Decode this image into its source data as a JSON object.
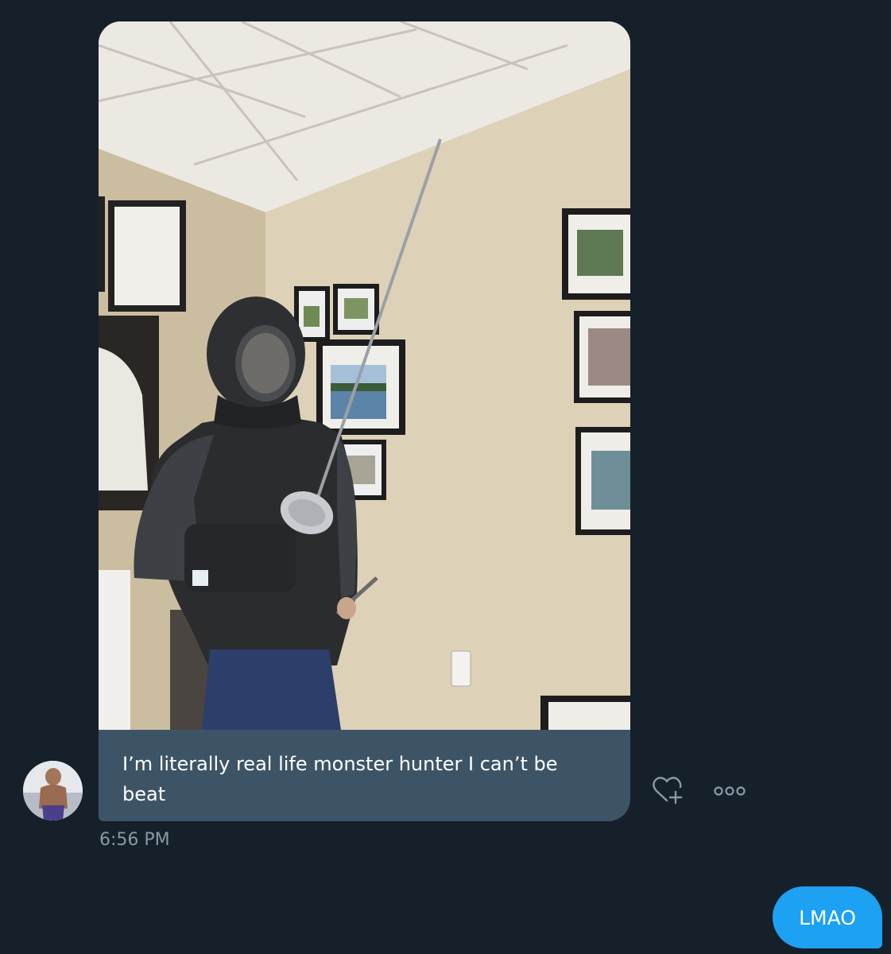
{
  "conversation": {
    "received_message": {
      "text": "I’m literally real life monster hunter I can’t be beat",
      "timestamp": "6:56 PM",
      "photo_alt": "Person in fencing gear holding a sword in an office",
      "react_icon": "heart-plus-icon",
      "more_icon": "more-horizontal-icon"
    },
    "sent_message": {
      "text": "LMAO"
    }
  },
  "colors": {
    "background": "#15202b",
    "received_bubble": "#3d5466",
    "sent_bubble": "#1da1f2",
    "timestamp": "#8899a6",
    "icon": "#8899a6"
  }
}
